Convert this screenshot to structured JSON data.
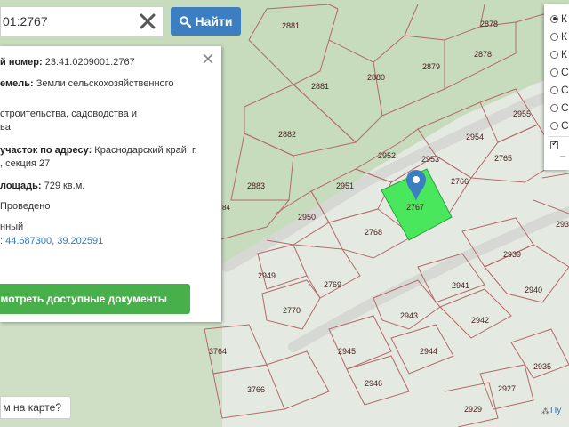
{
  "search": {
    "value": "01:2767",
    "button_label": "Найти"
  },
  "info": {
    "cad_number_label": "й номер:",
    "cad_number_value": "23:41:0209001:2767",
    "category_label": "емель:",
    "category_value": "Земли сельскохозяйственного",
    "usage_value": "строительства, садоводства и",
    "usage_value_2": "ва",
    "address_label": "участок по адресу:",
    "address_value": "Краснодарский край, г.",
    "address_value_2": ", секция 27",
    "area_label": "лощадь:",
    "area_value": "729 кв.м.",
    "status_value": "Проведено",
    "type_value": "нный",
    "coords_value": ": 44.687300, 39.202591",
    "docs_button_label": "мотреть доступные документы"
  },
  "bottom_help_label": "м на карте?",
  "layers": {
    "items": [
      {
        "label": "К",
        "type": "radio",
        "checked": true
      },
      {
        "label": "К",
        "type": "radio",
        "checked": false
      },
      {
        "label": "К",
        "type": "radio",
        "checked": false
      },
      {
        "label": "С",
        "type": "radio",
        "checked": false
      },
      {
        "label": "С",
        "type": "radio",
        "checked": false
      },
      {
        "label": "С",
        "type": "radio",
        "checked": false
      },
      {
        "label": "С",
        "type": "radio",
        "checked": false
      }
    ],
    "check_1_label": "",
    "check_2_label": "Т"
  },
  "attribution": "Пу",
  "map_labels": {
    "l2881a": "2881",
    "l2881b": "2881",
    "l2880": "2880",
    "l2879": "2879",
    "l2878": "2878",
    "l2878b": "2878",
    "l2882": "2882",
    "l2883": "2883",
    "l2955": "2955",
    "l2954": "2954",
    "l2953": "2953",
    "l2952": "2952",
    "l2765": "2765",
    "l2766": "2766",
    "l2951": "2951",
    "l2767": "2767",
    "l2950": "2950",
    "l2768": "2768",
    "l2939": "2939",
    "l2949": "2949",
    "l2769": "2769",
    "l2941": "2941",
    "l2940": "2940",
    "l2770": "2770",
    "l2943": "2943",
    "l2942": "2942",
    "l3764": "3764",
    "l2945": "2945",
    "l2944": "2944",
    "l2935": "2935",
    "l3766": "3766",
    "l2946": "2946",
    "l2927": "2927",
    "l2929": "2929",
    "l84": "84",
    "l293": "293"
  },
  "colors": {
    "selected_plot": "#49e85c",
    "plot_border": "#b46a6a",
    "marker": "#3b7ec2",
    "search_button": "#3b7ec2",
    "docs_button": "#48b04b",
    "forest": "#c8dcbf",
    "open": "#e6ebe3"
  }
}
